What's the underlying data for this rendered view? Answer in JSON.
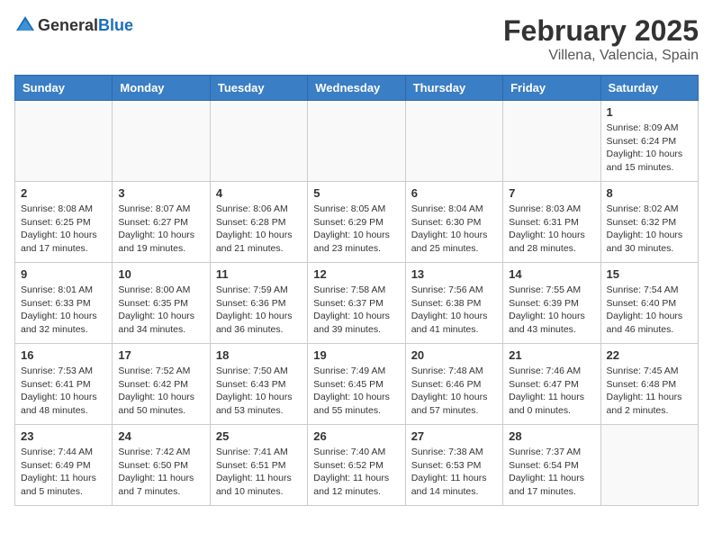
{
  "header": {
    "logo_general": "General",
    "logo_blue": "Blue",
    "title": "February 2025",
    "subtitle": "Villena, Valencia, Spain"
  },
  "weekdays": [
    "Sunday",
    "Monday",
    "Tuesday",
    "Wednesday",
    "Thursday",
    "Friday",
    "Saturday"
  ],
  "weeks": [
    [
      {
        "day": "",
        "info": ""
      },
      {
        "day": "",
        "info": ""
      },
      {
        "day": "",
        "info": ""
      },
      {
        "day": "",
        "info": ""
      },
      {
        "day": "",
        "info": ""
      },
      {
        "day": "",
        "info": ""
      },
      {
        "day": "1",
        "info": "Sunrise: 8:09 AM\nSunset: 6:24 PM\nDaylight: 10 hours and 15 minutes."
      }
    ],
    [
      {
        "day": "2",
        "info": "Sunrise: 8:08 AM\nSunset: 6:25 PM\nDaylight: 10 hours and 17 minutes."
      },
      {
        "day": "3",
        "info": "Sunrise: 8:07 AM\nSunset: 6:27 PM\nDaylight: 10 hours and 19 minutes."
      },
      {
        "day": "4",
        "info": "Sunrise: 8:06 AM\nSunset: 6:28 PM\nDaylight: 10 hours and 21 minutes."
      },
      {
        "day": "5",
        "info": "Sunrise: 8:05 AM\nSunset: 6:29 PM\nDaylight: 10 hours and 23 minutes."
      },
      {
        "day": "6",
        "info": "Sunrise: 8:04 AM\nSunset: 6:30 PM\nDaylight: 10 hours and 25 minutes."
      },
      {
        "day": "7",
        "info": "Sunrise: 8:03 AM\nSunset: 6:31 PM\nDaylight: 10 hours and 28 minutes."
      },
      {
        "day": "8",
        "info": "Sunrise: 8:02 AM\nSunset: 6:32 PM\nDaylight: 10 hours and 30 minutes."
      }
    ],
    [
      {
        "day": "9",
        "info": "Sunrise: 8:01 AM\nSunset: 6:33 PM\nDaylight: 10 hours and 32 minutes."
      },
      {
        "day": "10",
        "info": "Sunrise: 8:00 AM\nSunset: 6:35 PM\nDaylight: 10 hours and 34 minutes."
      },
      {
        "day": "11",
        "info": "Sunrise: 7:59 AM\nSunset: 6:36 PM\nDaylight: 10 hours and 36 minutes."
      },
      {
        "day": "12",
        "info": "Sunrise: 7:58 AM\nSunset: 6:37 PM\nDaylight: 10 hours and 39 minutes."
      },
      {
        "day": "13",
        "info": "Sunrise: 7:56 AM\nSunset: 6:38 PM\nDaylight: 10 hours and 41 minutes."
      },
      {
        "day": "14",
        "info": "Sunrise: 7:55 AM\nSunset: 6:39 PM\nDaylight: 10 hours and 43 minutes."
      },
      {
        "day": "15",
        "info": "Sunrise: 7:54 AM\nSunset: 6:40 PM\nDaylight: 10 hours and 46 minutes."
      }
    ],
    [
      {
        "day": "16",
        "info": "Sunrise: 7:53 AM\nSunset: 6:41 PM\nDaylight: 10 hours and 48 minutes."
      },
      {
        "day": "17",
        "info": "Sunrise: 7:52 AM\nSunset: 6:42 PM\nDaylight: 10 hours and 50 minutes."
      },
      {
        "day": "18",
        "info": "Sunrise: 7:50 AM\nSunset: 6:43 PM\nDaylight: 10 hours and 53 minutes."
      },
      {
        "day": "19",
        "info": "Sunrise: 7:49 AM\nSunset: 6:45 PM\nDaylight: 10 hours and 55 minutes."
      },
      {
        "day": "20",
        "info": "Sunrise: 7:48 AM\nSunset: 6:46 PM\nDaylight: 10 hours and 57 minutes."
      },
      {
        "day": "21",
        "info": "Sunrise: 7:46 AM\nSunset: 6:47 PM\nDaylight: 11 hours and 0 minutes."
      },
      {
        "day": "22",
        "info": "Sunrise: 7:45 AM\nSunset: 6:48 PM\nDaylight: 11 hours and 2 minutes."
      }
    ],
    [
      {
        "day": "23",
        "info": "Sunrise: 7:44 AM\nSunset: 6:49 PM\nDaylight: 11 hours and 5 minutes."
      },
      {
        "day": "24",
        "info": "Sunrise: 7:42 AM\nSunset: 6:50 PM\nDaylight: 11 hours and 7 minutes."
      },
      {
        "day": "25",
        "info": "Sunrise: 7:41 AM\nSunset: 6:51 PM\nDaylight: 11 hours and 10 minutes."
      },
      {
        "day": "26",
        "info": "Sunrise: 7:40 AM\nSunset: 6:52 PM\nDaylight: 11 hours and 12 minutes."
      },
      {
        "day": "27",
        "info": "Sunrise: 7:38 AM\nSunset: 6:53 PM\nDaylight: 11 hours and 14 minutes."
      },
      {
        "day": "28",
        "info": "Sunrise: 7:37 AM\nSunset: 6:54 PM\nDaylight: 11 hours and 17 minutes."
      },
      {
        "day": "",
        "info": ""
      }
    ]
  ]
}
